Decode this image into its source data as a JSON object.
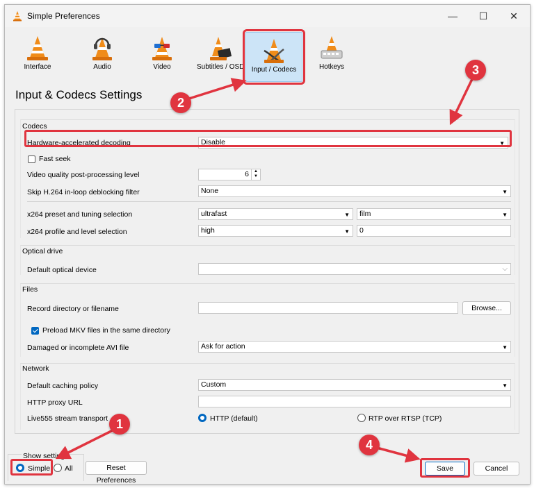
{
  "window": {
    "title": "Simple Preferences",
    "minimize": "—",
    "maximize": "☐",
    "close": "✕"
  },
  "tabs": [
    {
      "label": "Interface",
      "icon": "cone-icon"
    },
    {
      "label": "Audio",
      "icon": "headphones-cone-icon"
    },
    {
      "label": "Video",
      "icon": "glasses-cone-icon"
    },
    {
      "label": "Subtitles / OSD",
      "icon": "clapper-cone-icon"
    },
    {
      "label": "Input / Codecs",
      "icon": "cables-cone-icon"
    },
    {
      "label": "Hotkeys",
      "icon": "keyboard-cone-icon"
    }
  ],
  "heading": "Input & Codecs Settings",
  "codecs": {
    "title": "Codecs",
    "hw_label": "Hardware-accelerated decoding",
    "hw_value": "Disable",
    "fast_seek": "Fast seek",
    "vq_label": "Video quality post-processing level",
    "vq_value": "6",
    "skip_label": "Skip H.264 in-loop deblocking filter",
    "skip_value": "None",
    "x264_preset_label": "x264 preset and tuning selection",
    "x264_preset_value": "ultrafast",
    "x264_tune_value": "film",
    "x264_profile_label": "x264 profile and level selection",
    "x264_profile_value": "high",
    "x264_level_value": "0"
  },
  "optical": {
    "title": "Optical drive",
    "device_label": "Default optical device",
    "device_value": ""
  },
  "files": {
    "title": "Files",
    "record_label": "Record directory or filename",
    "record_value": "",
    "browse": "Browse...",
    "preload": "Preload MKV files in the same directory",
    "damaged_label": "Damaged or incomplete AVI file",
    "damaged_value": "Ask for action"
  },
  "network": {
    "title": "Network",
    "caching_label": "Default caching policy",
    "caching_value": "Custom",
    "proxy_label": "HTTP proxy URL",
    "proxy_value": "",
    "live_label": "Live555 stream transport",
    "http_option": "HTTP (default)",
    "rtp_option": "RTP over RTSP (TCP)"
  },
  "footer": {
    "show_settings": "Show settings",
    "simple": "Simple",
    "all": "All",
    "reset": "Reset Preferences",
    "save": "Save",
    "cancel": "Cancel"
  },
  "annotations": {
    "b1": "1",
    "b2": "2",
    "b3": "3",
    "b4": "4"
  },
  "colors": {
    "highlight": "#e0343f",
    "accent": "#0067c0",
    "tab_active": "#cce4f7"
  }
}
